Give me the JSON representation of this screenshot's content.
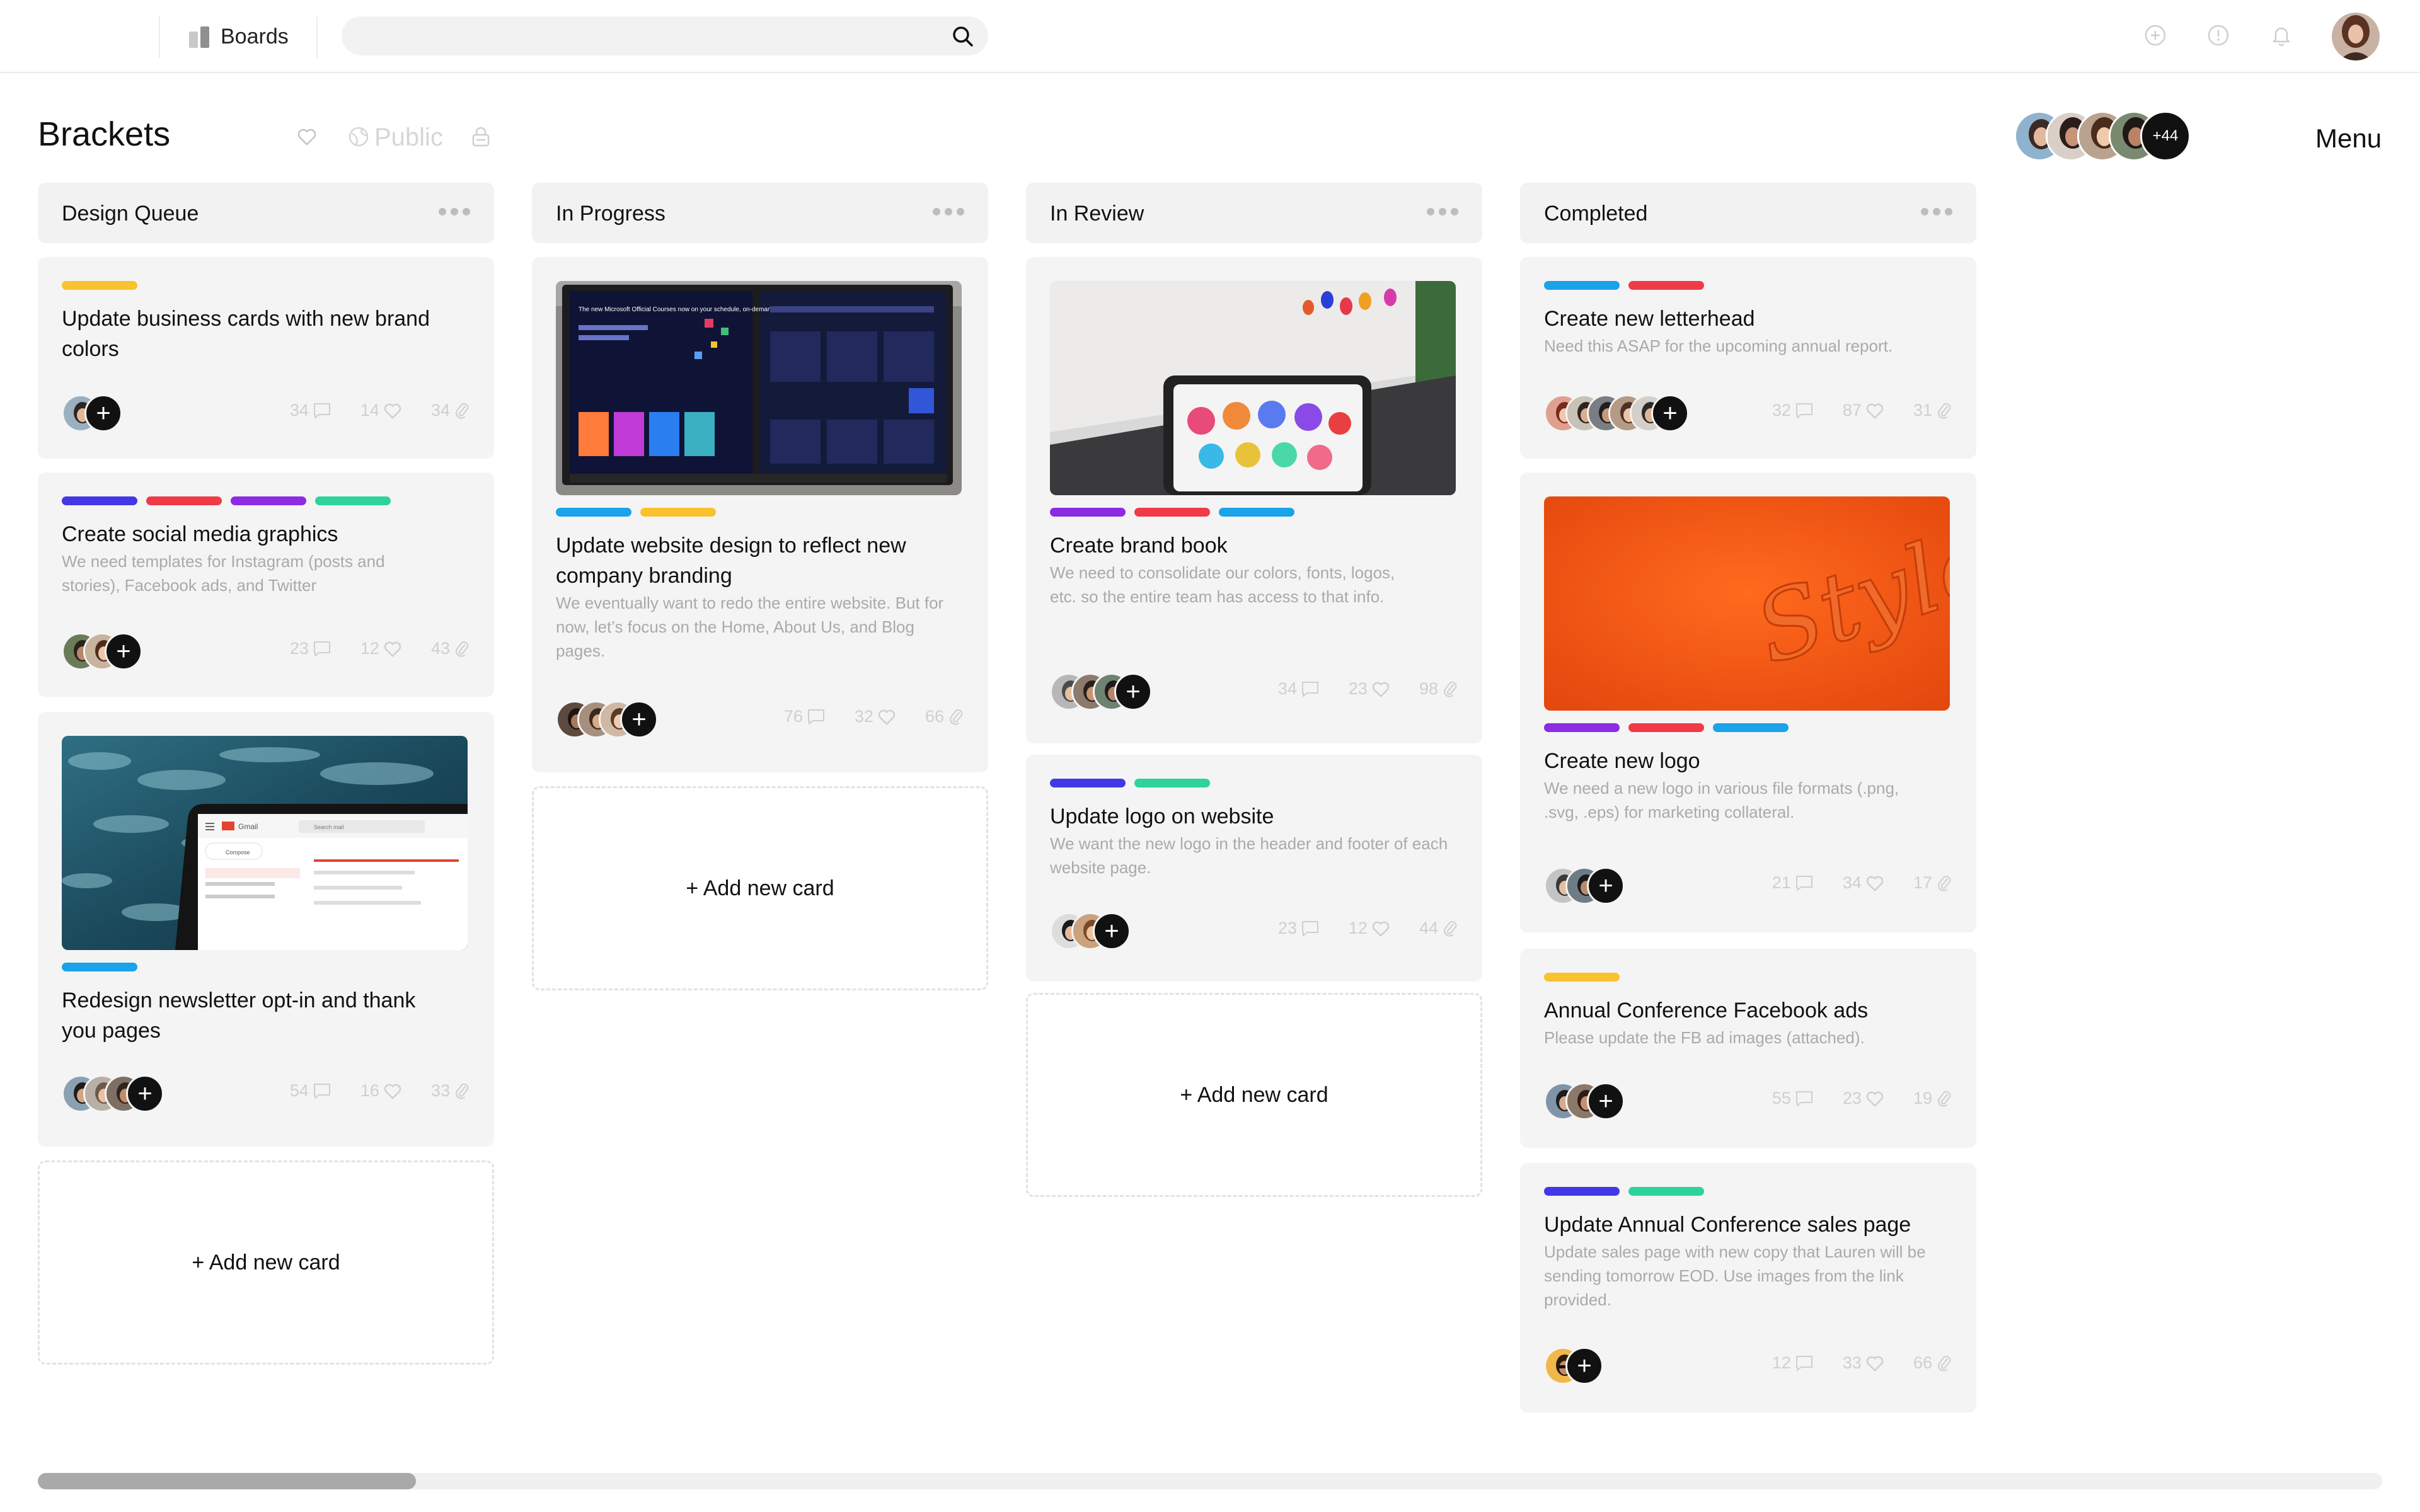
{
  "topbar": {
    "boards_label": "Boards",
    "search_placeholder": "",
    "icons": [
      "plus-circle-icon",
      "info-icon",
      "bell-icon"
    ]
  },
  "board": {
    "title": "Brackets",
    "visibility": "Public",
    "members_more": "+44",
    "menu_label": "Menu"
  },
  "colors": {
    "yellow": "#F9C22E",
    "red": "#F03A47",
    "purple": "#8B2BE2",
    "indigo": "#4338E8",
    "green": "#2ED39A",
    "blue": "#1AA3E8"
  },
  "columns": [
    {
      "title": "Design Queue",
      "add_label": "+ Add new card",
      "cards": [
        {
          "title": "Update business cards with new brand colors",
          "desc": "",
          "tags": [
            "yellow"
          ],
          "comments": "34",
          "likes": "14",
          "attachments": "34"
        },
        {
          "title": "Create social media graphics",
          "desc": "We need templates for Instagram (posts and stories), Facebook ads, and Twitter",
          "tags": [
            "indigo",
            "red",
            "purple",
            "green"
          ],
          "comments": "23",
          "likes": "12",
          "attachments": "43"
        },
        {
          "title": "Redesign newsletter opt-in and thank you pages",
          "desc": "",
          "tags": [
            "blue"
          ],
          "comments": "54",
          "likes": "16",
          "attachments": "33"
        }
      ]
    },
    {
      "title": "In Progress",
      "add_label": "+ Add new card",
      "cards": [
        {
          "title": "Update website design to reflect new company branding",
          "desc": "We eventually want to redo the entire website. But for now, let’s focus on the Home, About Us, and Blog pages.",
          "tags": [
            "blue",
            "yellow"
          ],
          "comments": "76",
          "likes": "32",
          "attachments": "66"
        }
      ]
    },
    {
      "title": "In Review",
      "add_label": "+ Add new card",
      "cards": [
        {
          "title": "Create brand book",
          "desc": "We need to consolidate our colors, fonts, logos, etc. so the entire team has access to that info.",
          "tags": [
            "purple",
            "red",
            "blue"
          ],
          "comments": "34",
          "likes": "23",
          "attachments": "98"
        },
        {
          "title": "Update logo on website",
          "desc": "We want the new logo in the header and footer of each website page.",
          "tags": [
            "indigo",
            "green"
          ],
          "comments": "23",
          "likes": "12",
          "attachments": "44"
        }
      ]
    },
    {
      "title": "Completed",
      "cards": [
        {
          "title": "Create new letterhead",
          "desc": "Need this ASAP for the upcoming annual report.",
          "tags": [
            "blue",
            "red"
          ],
          "comments": "32",
          "likes": "87",
          "attachments": "31"
        },
        {
          "title": "Create new logo",
          "desc": "We need a new logo in various file formats (.png, .svg, .eps) for marketing collateral.",
          "tags": [
            "purple",
            "red",
            "blue"
          ],
          "comments": "21",
          "likes": "34",
          "attachments": "17",
          "image_text": "Style"
        },
        {
          "title": "Annual Conference Facebook ads",
          "desc": "Please update the FB ad images (attached).",
          "tags": [
            "yellow"
          ],
          "comments": "55",
          "likes": "23",
          "attachments": "19"
        },
        {
          "title": "Update Annual Conference sales page",
          "desc": "Update sales page with new copy that Lauren will be sending tomorrow EOD. Use images from the link provided.",
          "tags": [
            "indigo",
            "green"
          ],
          "comments": "12",
          "likes": "33",
          "attachments": "66"
        }
      ]
    }
  ],
  "mockup_text": {
    "gmail_label": "Gmail",
    "gmail_compose": "Compose",
    "gmail_search": "Search mail",
    "monitor_headline": "The new Microsoft Official Courses now on your schedule, on-demand"
  }
}
